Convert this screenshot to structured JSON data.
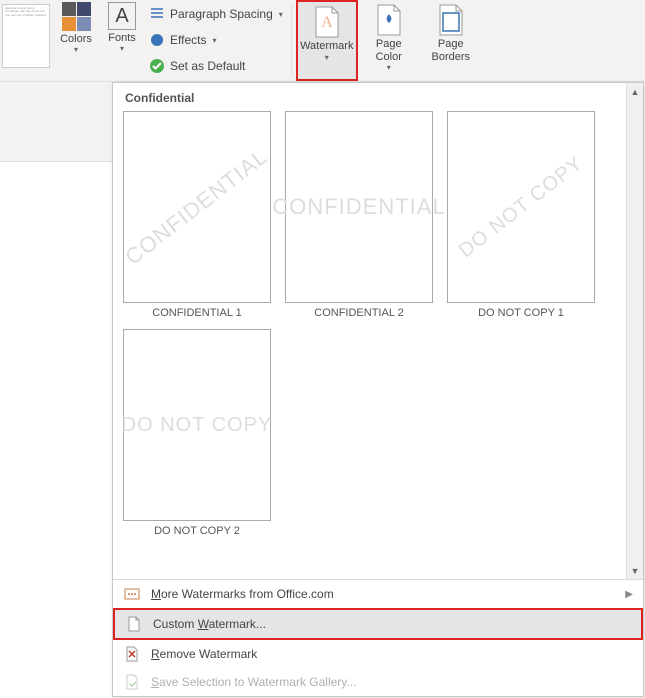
{
  "ribbon": {
    "gallery_thumb_text": "galleries include items coordinate with the document. You can use of tables, headers,",
    "colors_label": "Colors",
    "fonts_label": "Fonts",
    "paragraph_spacing_label": "Paragraph Spacing",
    "effects_label": "Effects",
    "set_default_label": "Set as Default",
    "watermark_label": "Watermark",
    "page_color_label": "Page\nColor",
    "page_borders_label": "Page\nBorders",
    "colors_swatches": [
      "#5a5a5a",
      "#3f4a6d",
      "#e69138",
      "#7b8db5"
    ]
  },
  "gallery": {
    "section_header": "Confidential",
    "thumbs": [
      {
        "watermark": "CONFIDENTIAL",
        "label": "CONFIDENTIAL 1",
        "diagonal": true
      },
      {
        "watermark": "CONFIDENTIAL",
        "label": "CONFIDENTIAL 2",
        "diagonal": false
      },
      {
        "watermark": "DO NOT COPY",
        "label": "DO NOT COPY 1",
        "diagonal": true
      },
      {
        "watermark": "DO NOT COPY",
        "label": "DO NOT COPY 2",
        "diagonal": false
      }
    ],
    "menu": {
      "more": "More Watermarks from Office.com",
      "custom": "Custom Watermark...",
      "remove": "Remove Watermark",
      "save_sel": "Save Selection to Watermark Gallery..."
    }
  }
}
